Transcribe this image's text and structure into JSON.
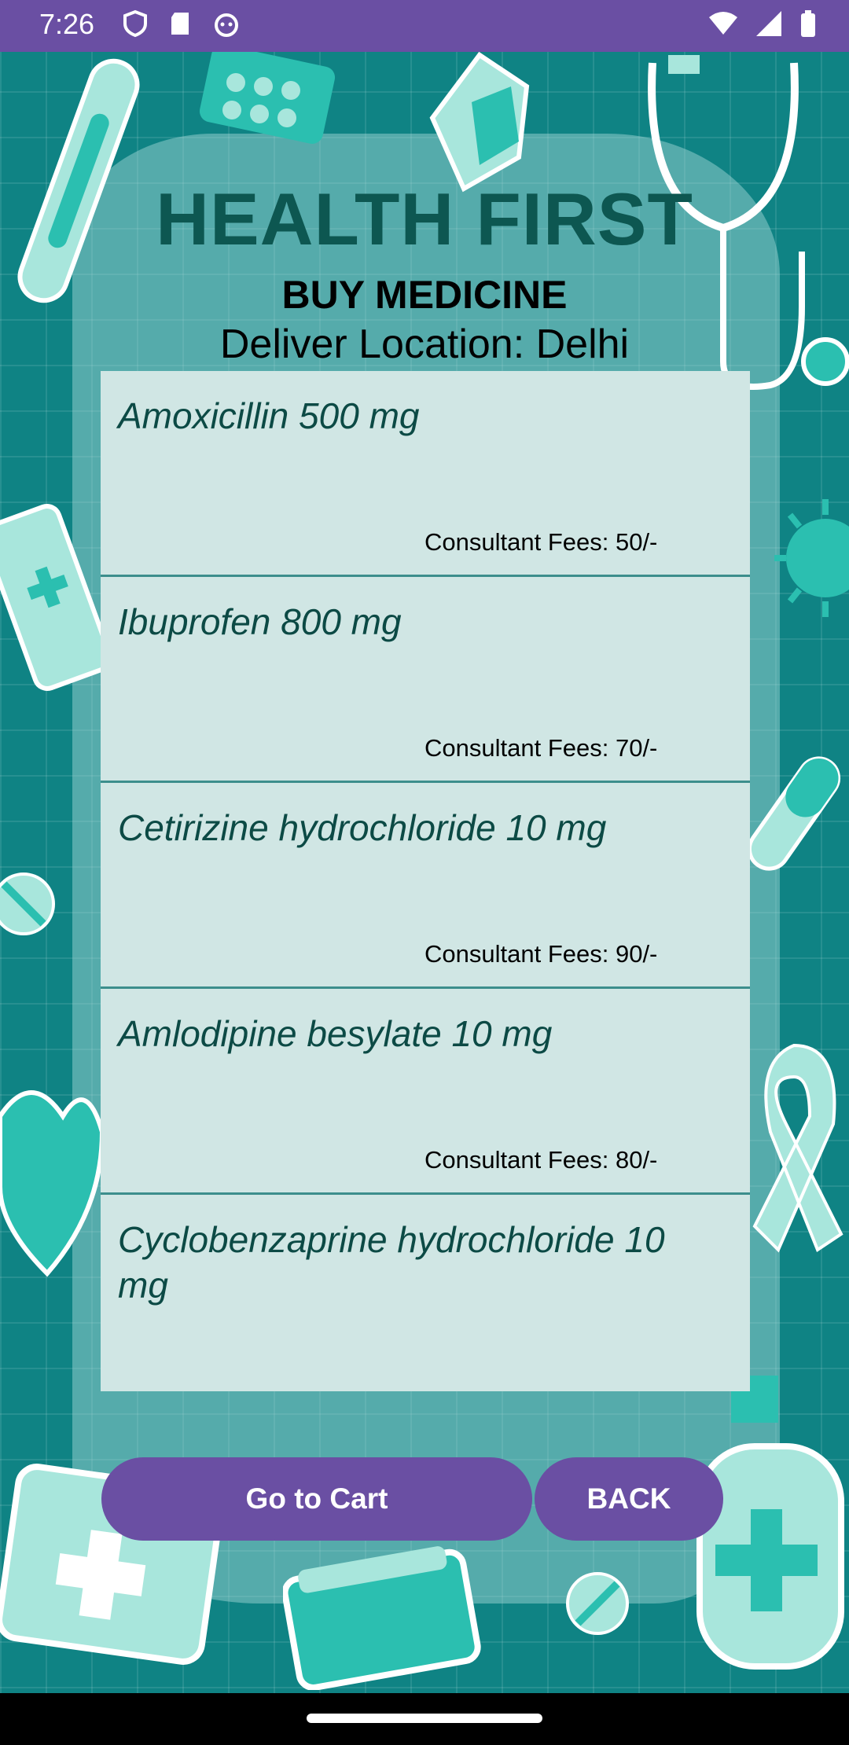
{
  "status_bar": {
    "time": "7:26",
    "left_icons": [
      "shield-icon",
      "sd-card-icon",
      "cat-icon"
    ],
    "right_icons": [
      "wifi-icon",
      "signal-icon",
      "battery-icon"
    ]
  },
  "header": {
    "title": "HEALTH FIRST",
    "subtitle": "BUY MEDICINE",
    "location": "Deliver Location: Delhi"
  },
  "medicines": [
    {
      "name": "Amoxicillin 500 mg",
      "fee": "Consultant Fees: 50/-"
    },
    {
      "name": "Ibuprofen 800 mg",
      "fee": "Consultant Fees: 70/-"
    },
    {
      "name": "Cetirizine hydrochloride 10 mg",
      "fee": "Consultant Fees: 90/-"
    },
    {
      "name": "Amlodipine besylate 10 mg",
      "fee": "Consultant Fees: 80/-"
    },
    {
      "name": "Cyclobenzaprine hydrochloride 10 mg",
      "fee": ""
    }
  ],
  "buttons": {
    "cart_label": "Go to Cart",
    "back_label": "BACK"
  },
  "colors": {
    "accent": "#6a4fa3",
    "background": "#0f8384",
    "title": "#0d5751",
    "list_bg": "#d0e6e4"
  }
}
